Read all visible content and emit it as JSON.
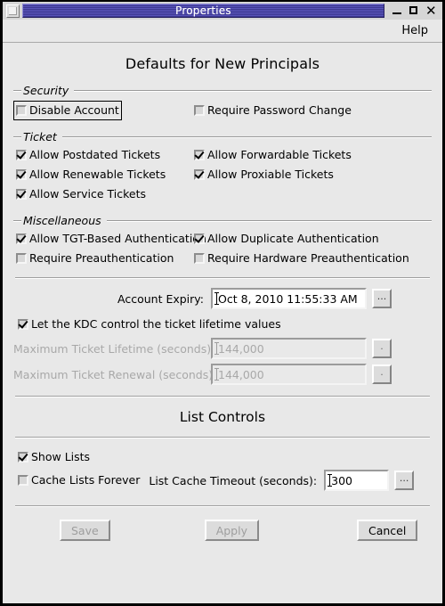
{
  "window": {
    "title": "Properties",
    "controls": {
      "system_menu": "system-menu",
      "minimize": "–",
      "maximize": "□",
      "close": "✕"
    }
  },
  "menubar": {
    "items": [
      {
        "label": "Help"
      }
    ]
  },
  "page": {
    "title": "Defaults for New Principals"
  },
  "security": {
    "legend": "Security",
    "checkboxes": [
      {
        "label": "Disable Account",
        "checked": false,
        "focused": true,
        "enabled": true
      },
      {
        "label": "Require Password Change",
        "checked": false,
        "focused": false,
        "enabled": true
      }
    ]
  },
  "ticket": {
    "legend": "Ticket",
    "left": [
      {
        "label": "Allow Postdated Tickets",
        "checked": true,
        "enabled": true
      },
      {
        "label": "Allow Renewable Tickets",
        "checked": true,
        "enabled": true
      },
      {
        "label": "Allow Service Tickets",
        "checked": true,
        "enabled": true
      }
    ],
    "right": [
      {
        "label": "Allow Forwardable Tickets",
        "checked": true,
        "enabled": true
      },
      {
        "label": "Allow Proxiable Tickets",
        "checked": true,
        "enabled": true
      }
    ]
  },
  "miscellaneous": {
    "legend": "Miscellaneous",
    "left": [
      {
        "label": "Allow TGT-Based Authentication",
        "checked": true,
        "enabled": true
      },
      {
        "label": "Require Preauthentication",
        "checked": false,
        "enabled": true
      }
    ],
    "right": [
      {
        "label": "Allow Duplicate Authentication",
        "checked": true,
        "enabled": true
      },
      {
        "label": "Require Hardware Preauthentication",
        "checked": false,
        "enabled": true
      }
    ]
  },
  "account_expiry": {
    "label": "Account Expiry:",
    "value": "Oct 8, 2010 11:55:33 AM",
    "browse_label": "..."
  },
  "kdc_control": {
    "label": "Let the KDC control the ticket lifetime values",
    "checked": true
  },
  "lifetime_fields": [
    {
      "label": "Maximum Ticket Lifetime (seconds)",
      "value": "144,000",
      "enabled": false,
      "browse_label": "."
    },
    {
      "label": "Maximum Ticket Renewal (seconds)",
      "value": "144,000",
      "enabled": false,
      "browse_label": "."
    }
  ],
  "list_controls": {
    "title": "List Controls",
    "show_lists": {
      "label": "Show Lists",
      "checked": true
    },
    "cache_forever": {
      "label": "Cache Lists Forever",
      "checked": false
    },
    "timeout": {
      "label": "List Cache Timeout (seconds):",
      "value": "300",
      "browse_label": "..."
    }
  },
  "buttons": [
    {
      "label": "Save",
      "enabled": false
    },
    {
      "label": "Apply",
      "enabled": false
    },
    {
      "label": "Cancel",
      "enabled": true
    }
  ],
  "colors": {
    "titlebar": "#4a46a8",
    "face": "#e8e8e8",
    "field": "#ffffff",
    "disabled_text": "#9e9e9e"
  }
}
